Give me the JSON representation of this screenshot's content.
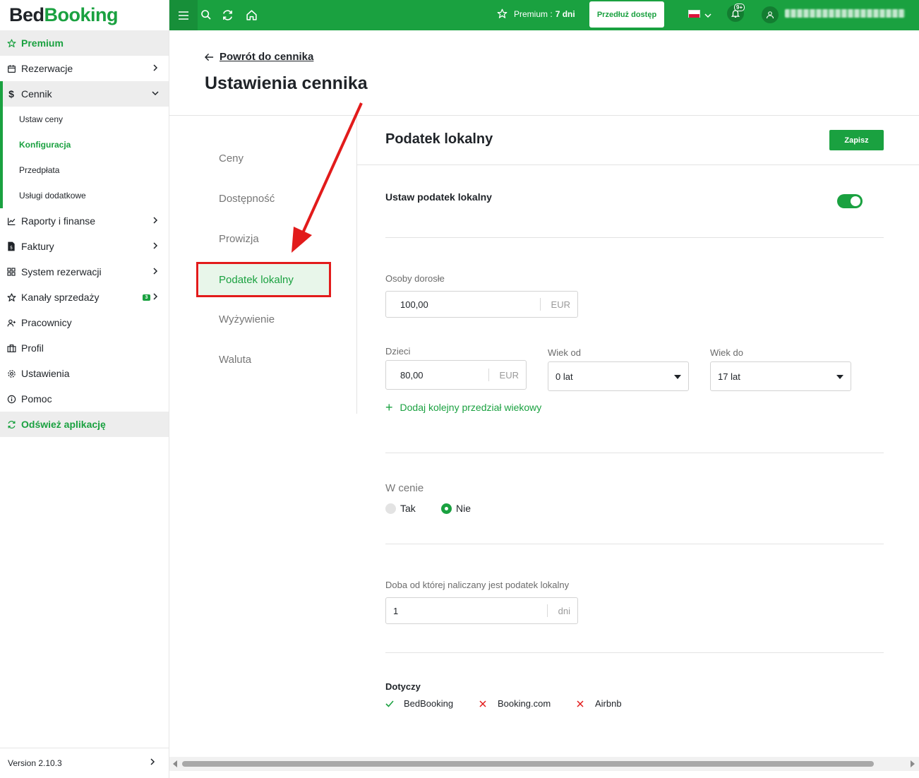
{
  "app": {
    "logo_part1": "Bed",
    "logo_part2": "Booking",
    "version": "Version 2.10.3"
  },
  "sidebar": {
    "premium": "Premium",
    "items": [
      {
        "label": "Rezerwacje"
      },
      {
        "label": "Cennik"
      },
      {
        "label": "Raporty i finanse"
      },
      {
        "label": "Faktury"
      },
      {
        "label": "System rezerwacji"
      },
      {
        "label": "Kanały sprzedaży",
        "badge": "3"
      },
      {
        "label": "Pracownicy"
      },
      {
        "label": "Profil"
      },
      {
        "label": "Ustawienia"
      },
      {
        "label": "Pomoc"
      }
    ],
    "sub_items": [
      "Ustaw ceny",
      "Konfiguracja",
      "Przedpłata",
      "Usługi dodatkowe"
    ],
    "refresh": "Odśwież aplikację"
  },
  "topbar": {
    "premium_label": "Premium :",
    "premium_days": "7 dni",
    "extend_button": "Przedłuż dostęp",
    "notifications": "9+"
  },
  "page": {
    "back_link": "Powrót do cennika",
    "title": "Ustawienia cennika",
    "tabs": [
      "Ceny",
      "Dostępność",
      "Prowizja",
      "Podatek lokalny",
      "Wyżywienie",
      "Waluta"
    ],
    "section_title": "Podatek lokalny",
    "save_button": "Zapisz",
    "toggle_label": "Ustaw podatek lokalny",
    "adults": {
      "label": "Osoby dorosłe",
      "value": "100,00",
      "unit": "EUR"
    },
    "children": {
      "label": "Dzieci",
      "value": "80,00",
      "unit": "EUR",
      "age_from_label": "Wiek od",
      "age_from_value": "0 lat",
      "age_to_label": "Wiek do",
      "age_to_value": "17 lat"
    },
    "add_range": "Dodaj kolejny przedział wiekowy",
    "in_price": {
      "label": "W cenie",
      "options": [
        "Tak",
        "Nie"
      ],
      "selected": "Nie"
    },
    "night_from": {
      "label": "Doba od której naliczany jest podatek lokalny",
      "value": "1",
      "unit": "dni"
    },
    "applies": {
      "title": "Dotyczy",
      "channels": [
        {
          "name": "BedBooking",
          "status": "check"
        },
        {
          "name": "Booking.com",
          "status": "cross"
        },
        {
          "name": "Airbnb",
          "status": "cross"
        }
      ]
    }
  },
  "colors": {
    "brand": "#1aa140",
    "annotation": "#e21b1b"
  }
}
